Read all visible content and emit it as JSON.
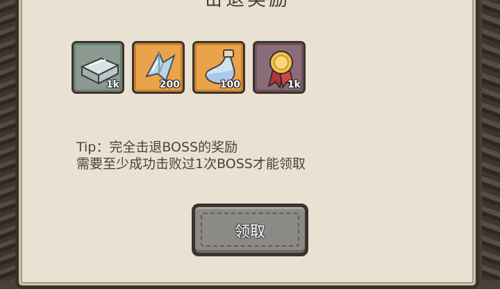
{
  "dialog": {
    "title": "击退奖励"
  },
  "rewards": [
    {
      "icon": "metal-ingot-icon",
      "qty": "1k"
    },
    {
      "icon": "crystal-shard-icon",
      "qty": "200"
    },
    {
      "icon": "potion-bottle-icon",
      "qty": "100"
    },
    {
      "icon": "gold-medal-icon",
      "qty": "1k"
    }
  ],
  "tip": {
    "line1": "Tip：完全击退BOSS的奖励",
    "line2": "需要至少成功击败过1次BOSS才能领取"
  },
  "claim_button": {
    "label": "领取"
  },
  "colors": {
    "panel": "#e9e1d2",
    "border": "#3a3128",
    "button": "#8b8a86"
  }
}
